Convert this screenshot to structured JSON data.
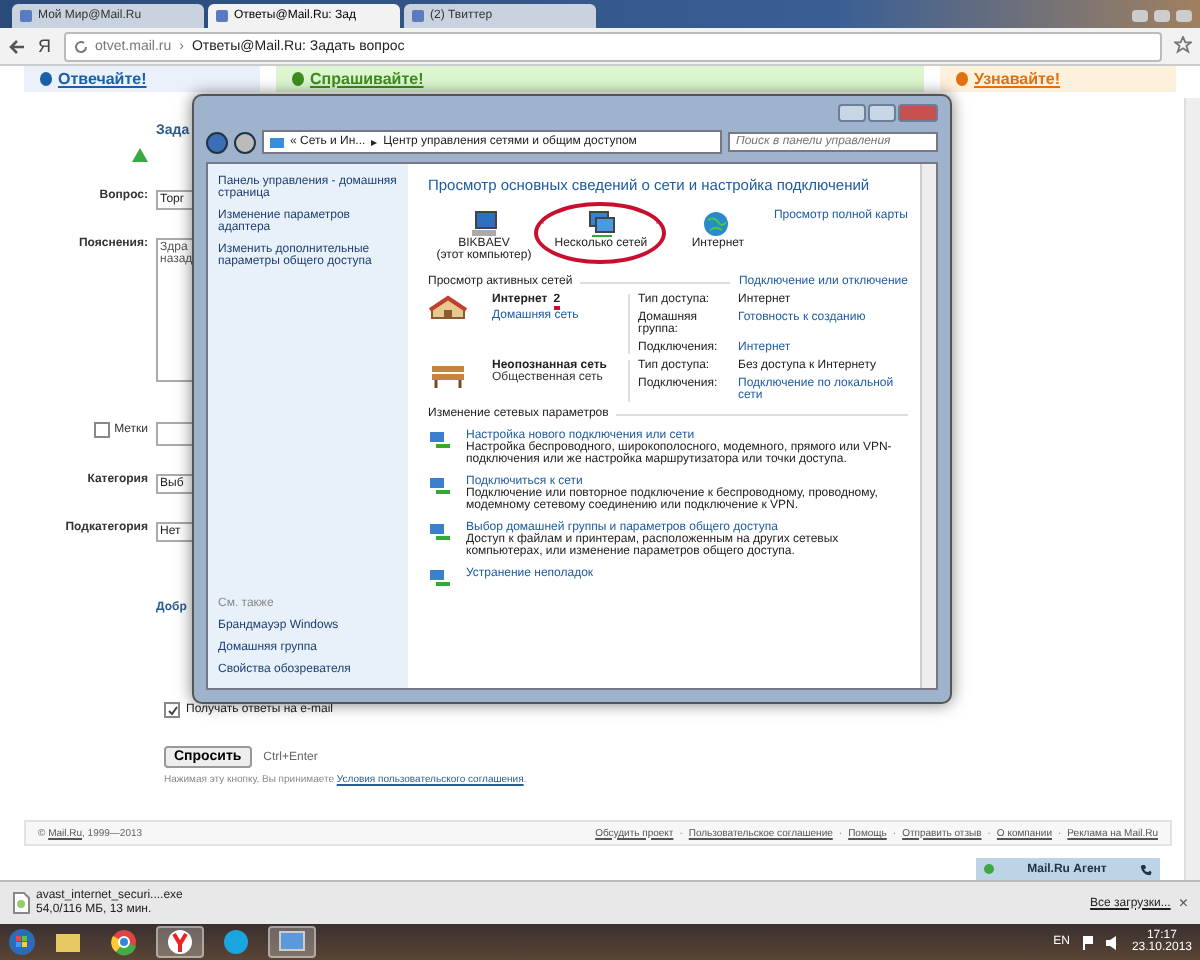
{
  "browser": {
    "tabs": [
      {
        "label": "Мой Мир@Mail.Ru",
        "selected": false
      },
      {
        "label": "Ответы@Mail.Ru: Зад",
        "selected": true
      },
      {
        "label": "(2) Твиттер",
        "selected": false
      }
    ],
    "address": {
      "host": "otvet.mail.ru",
      "separator": "›",
      "title": "Ответы@Mail.Ru: Задать вопрос"
    },
    "logo": "Я"
  },
  "page": {
    "banners": [
      {
        "label": "Отвечайте!",
        "color": "#1a5fa8"
      },
      {
        "label": "Спрашивайте!",
        "color": "#3d8c1e"
      },
      {
        "label": "Узнавайте!",
        "color": "#e07010"
      }
    ],
    "heading": "Зада",
    "form": [
      {
        "kind": "field",
        "label": "Вопрос:",
        "value": [
          "Торг"
        ]
      },
      {
        "kind": "textarea",
        "label": "Пояснения:",
        "value": [
          "Здра",
          "назад"
        ]
      },
      {
        "kind": "tags",
        "label": "Метки",
        "checked": false
      },
      {
        "kind": "field",
        "label": "Категория",
        "value": [
          "Выб"
        ]
      },
      {
        "kind": "field",
        "label": "Подкатегория",
        "value": [
          "Нет"
        ]
      }
    ],
    "more_link": "Добр",
    "email_option": {
      "label": "Получать ответы на e-mail",
      "checked": true
    },
    "submit": "Спросить",
    "shortcut": "Ctrl+Enter",
    "terms": {
      "text": "Нажимая эту кнопку, Вы принимаете",
      "link": "Условия пользовательского соглашения",
      "end": "."
    },
    "footer": {
      "copyright_sign": "©",
      "copyright_link": "Mail.Ru",
      "copyright_years": ", 1999—2013",
      "separator": "·",
      "links": [
        "Обсудить проект",
        "Пользовательское соглашение",
        "Помощь",
        "Отправить отзыв",
        "О компании",
        "Реклама на Mail.Ru"
      ]
    },
    "agent": "Mail.Ru Агент"
  },
  "window": {
    "breadcrumb_separator": "▸",
    "breadcrumb": [
      "« Сеть и Ин...",
      "Центр управления сетями и общим доступом"
    ],
    "search": {
      "placeholder": "Поиск в панели управления"
    },
    "sidebar": {
      "links": [
        "Панель управления - домашняя страница",
        "Изменение параметров адаптера",
        "Изменить дополнительные параметры общего доступа"
      ],
      "see_also": "См. также",
      "see_also_links": [
        "Брандмауэр Windows",
        "Домашняя группа",
        "Свойства обозревателя"
      ]
    },
    "title": "Просмотр основных сведений о сети и настройка подключений",
    "map": {
      "nodes": [
        {
          "kind": "computer",
          "label": "BIKBAEV\n(этот компьютер)"
        },
        {
          "kind": "networks",
          "label": "Несколько сетей",
          "circled": true
        },
        {
          "kind": "globe",
          "label": "Интернет"
        }
      ],
      "full_map": "Просмотр полной карты"
    },
    "active_title": "Просмотр активных сетей",
    "connect_link": "Подключение или отключение",
    "networks": [
      {
        "kind": "home",
        "name": "Интернет",
        "number": "2",
        "type": "Домашняя сеть",
        "props": [
          {
            "label": "Тип доступа:",
            "value": "Интернет",
            "link": false
          },
          {
            "label": "Домашняя группа:",
            "value": "Готовность к созданию",
            "link": true
          },
          {
            "label": "Подключения:",
            "value": "Интернет",
            "link": true
          }
        ]
      },
      {
        "kind": "bench",
        "name": "Неопознанная сеть",
        "type": "Общественная сеть",
        "props": [
          {
            "label": "Тип доступа:",
            "value": "Без доступа к Интернету",
            "link": false
          },
          {
            "label": "Подключения:",
            "value": "Подключение по локальной сети",
            "link": true
          }
        ]
      }
    ],
    "change_title": "Изменение сетевых параметров",
    "tasks": [
      {
        "title": "Настройка нового подключения или сети",
        "desc": "Настройка беспроводного, широкополосного, модемного, прямого или VPN-подключения или же настройка маршрутизатора или точки доступа."
      },
      {
        "title": "Подключиться к сети",
        "desc": "Подключение или повторное подключение к беспроводному, проводному, модемному сетевому соединению или подключение к VPN."
      },
      {
        "title": "Выбор домашней группы и параметров общего доступа",
        "desc": "Доступ к файлам и принтерам, расположенным на других сетевых компьютерах, или изменение параметров общего доступа."
      },
      {
        "title": "Устранение неполадок"
      }
    ]
  },
  "downloads": {
    "file": "avast_internet_securi....exe",
    "progress": "54,0/116 МБ, 13 мин.",
    "all": "Все загрузки...",
    "close": "×"
  },
  "taskbar": {
    "apps": [
      {
        "kind": "folder",
        "active": false
      },
      {
        "kind": "chrome",
        "active": false
      },
      {
        "kind": "yandex",
        "active": true
      },
      {
        "kind": "skype",
        "active": false
      },
      {
        "kind": "network",
        "active": true
      }
    ],
    "lang": "EN",
    "time": "17:17",
    "date": "23.10.2013"
  }
}
